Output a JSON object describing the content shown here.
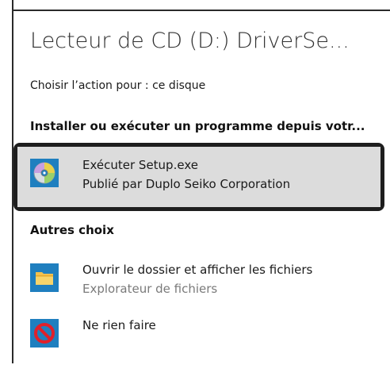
{
  "title": "Lecteur de CD (D:) DriverSe...",
  "subtitle": "Choisir l’action pour : ce disque",
  "sections": {
    "install": {
      "header": "Installer ou exécuter un programme depuis votr...",
      "option": {
        "icon": "cd-disc-icon",
        "line1": "Exécuter Setup.exe",
        "line2": "Publié par Duplo Seiko Corporation",
        "highlighted": true
      }
    },
    "other": {
      "header": "Autres choix",
      "options": [
        {
          "icon": "folder-icon",
          "line1": "Ouvrir le dossier et afficher les fichiers",
          "line2": "Explorateur de fichiers"
        },
        {
          "icon": "no-entry-icon",
          "line1": "Ne rien faire"
        }
      ]
    }
  },
  "colors": {
    "accent": "#1f7fbf",
    "highlight": "#dcdcdc",
    "callout_border": "#1e1e1e",
    "muted_text": "#7a7a7a"
  }
}
